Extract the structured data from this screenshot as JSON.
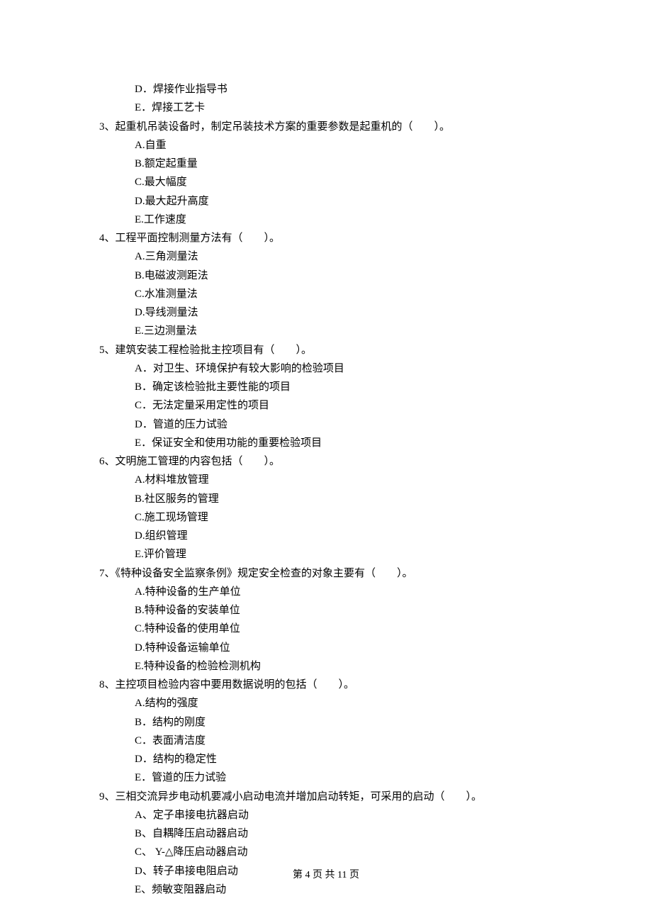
{
  "partial": {
    "options": [
      "D．焊接作业指导书",
      "E．焊接工艺卡"
    ]
  },
  "questions": [
    {
      "stem": "3、起重机吊装设备时，制定吊装技术方案的重要参数是起重机的（　　）。",
      "options": [
        "A.自重",
        "B.额定起重量",
        "C.最大幅度",
        "D.最大起升高度",
        "E.工作速度"
      ]
    },
    {
      "stem": "4、工程平面控制测量方法有（　　）。",
      "options": [
        "A.三角测量法",
        "B.电磁波测距法",
        "C.水准测量法",
        "D.导线测量法",
        "E.三边测量法"
      ]
    },
    {
      "stem": "5、建筑安装工程检验批主控项目有（　　）。",
      "options": [
        "A．对卫生、环境保护有较大影响的检验项目",
        "B．确定该检验批主要性能的项目",
        "C．无法定量采用定性的项目",
        "D．管道的压力试验",
        "E．保证安全和使用功能的重要检验项目"
      ]
    },
    {
      "stem": "6、文明施工管理的内容包括（　　）。",
      "options": [
        "A.材料堆放管理",
        "B.社区服务的管理",
        "C.施工现场管理",
        "D.组织管理",
        "E.评价管理"
      ]
    },
    {
      "stem": "7、《特种设备安全监察条例》规定安全检查的对象主要有（　　）。",
      "options": [
        "A.特种设备的生产单位",
        "B.特种设备的安装单位",
        "C.特种设备的使用单位",
        "D.特种设备运输单位",
        "E.特种设备的检验检测机构"
      ]
    },
    {
      "stem": "8、主控项目检验内容中要用数据说明的包括（　　）。",
      "options": [
        "A.结构的强度",
        "B．结构的刚度",
        "C．表面清洁度",
        "D．结构的稳定性",
        "E．管道的压力试验"
      ]
    },
    {
      "stem": "9、三相交流异步电动机要减小启动电流并增加启动转矩，可采用的启动（　　）。",
      "options": [
        "A、定子串接电抗器启动",
        "B、自耦降压启动器启动",
        "C、 Y-△降压启动器启动",
        "D、转子串接电阻启动",
        "E、频敏变阻器启动"
      ]
    }
  ],
  "footer": "第 4 页 共 11 页"
}
